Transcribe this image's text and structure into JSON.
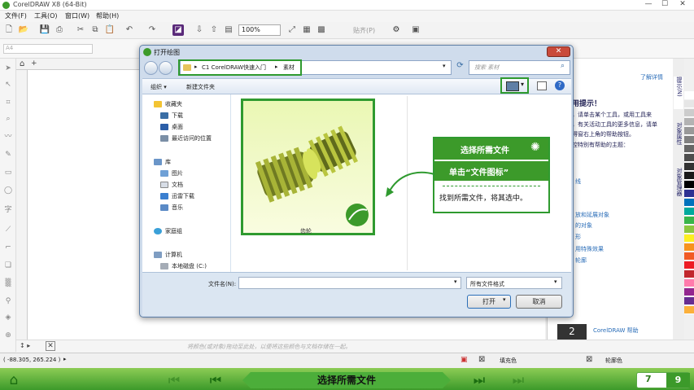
{
  "app": {
    "title": "CorelDRAW X8 (64-Bit)"
  },
  "menu": [
    "文件(F)",
    "工具(O)",
    "窗口(W)",
    "帮助(H)"
  ],
  "toolbar": {
    "zoom": "100%",
    "paste_label": "贴齐(P)"
  },
  "property_bar": {
    "page_size": "A4"
  },
  "docker": {
    "link_learn_more": "了解详情",
    "heading": "用提示！",
    "lines": [
      "，请单击某个工具，或用工具来",
      "，有关活动工具的更多信息，请单",
      "得窗右上角的帮助按钮。",
      "控特别有帮助的主题："
    ],
    "links": [
      "线",
      "放和延展对象",
      "的对象",
      "形",
      "用特殊效果",
      "轮廓"
    ],
    "help_label": "CorelDRAW 帮助",
    "help_number": "2"
  },
  "vertical_tabs": [
    "提示(N)",
    "对象属性",
    "对象管理器"
  ],
  "palette_colors": [
    "#ffffff",
    "#e6e6e6",
    "#cccccc",
    "#b3b3b3",
    "#999999",
    "#808080",
    "#666666",
    "#4d4d4d",
    "#333333",
    "#1a1a1a",
    "#000000",
    "#2e3192",
    "#0071bc",
    "#00a99d",
    "#39b54a",
    "#8cc63f",
    "#fcee21",
    "#f7931e",
    "#f15a24",
    "#ed1c24",
    "#c1272d",
    "#ff7bac",
    "#93278f",
    "#662d91",
    "#fbb03b"
  ],
  "status": {
    "coords": "( -88.305, 265.224 )",
    "hint": "将颜色(或对象)拖动至此处，以便将这些颜色与文档存储在一起。",
    "fill_label": "填充色",
    "outline_label": "轮廓色"
  },
  "dialog": {
    "title": "打开绘图",
    "breadcrumb": [
      "C1 CorelDRAW快速入门",
      "素材"
    ],
    "search_placeholder": "搜索 素材",
    "toolbar": {
      "organize": "组织 ▾",
      "new_folder": "新建文件夹"
    },
    "nav": {
      "favorites": "收藏夹",
      "fav_items": [
        "下载",
        "桌面",
        "最近访问的位置"
      ],
      "libraries": "库",
      "lib_items": [
        "图片",
        "文档",
        "迅雷下载",
        "音乐"
      ],
      "homegroup": "家庭组",
      "computer": "计算机",
      "drive": "本地磁盘 (C:)"
    },
    "file": {
      "name": "齿轮"
    },
    "filename_label": "文件名(N):",
    "filename_value": "",
    "filetype": "所有文件格式",
    "open_button": "打开",
    "cancel_button": "取消"
  },
  "callout": {
    "title": "选择所需文件",
    "step": "单击“文件图标”",
    "desc": "找到所需文件，将其选中。"
  },
  "tutorial": {
    "title": "选择所需文件",
    "page_current": "7",
    "page_next": "9"
  }
}
